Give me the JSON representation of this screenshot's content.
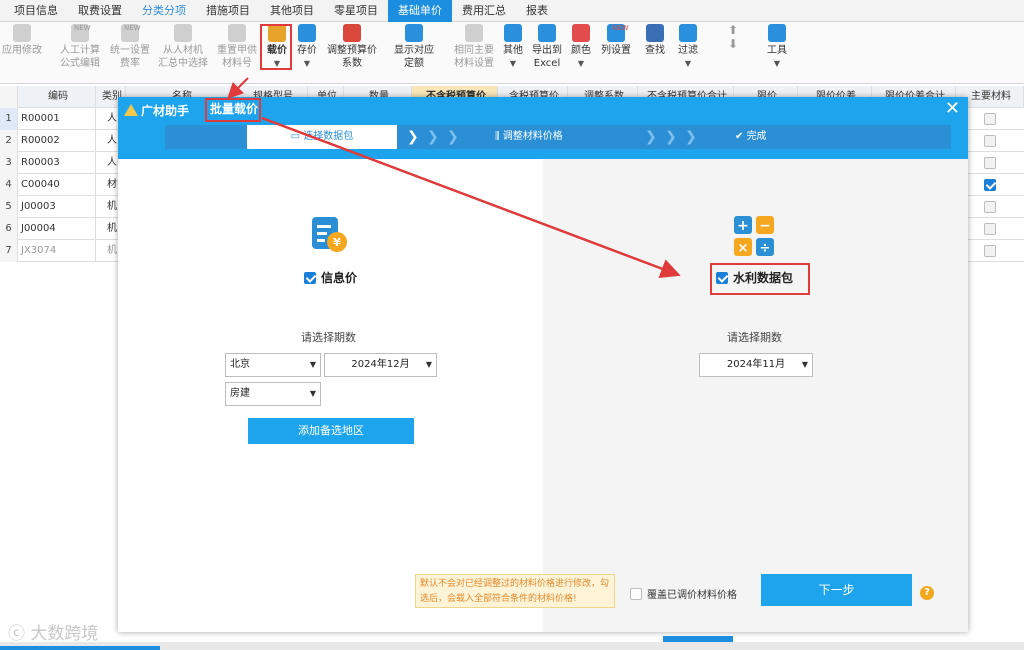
{
  "tabs": [
    "项目信息",
    "取费设置",
    "分类分项",
    "措施项目",
    "其他项目",
    "零星项目",
    "基础单价",
    "费用汇总",
    "报表"
  ],
  "ribbon": {
    "apply_modify": "应用修改",
    "labor_calc": [
      "人工计算",
      "公式编辑"
    ],
    "unify_rate": [
      "统一设置",
      "费率"
    ],
    "from_summary": [
      "从人材机",
      "汇总中选择"
    ],
    "reset_supplied": [
      "重置甲供",
      "材料号"
    ],
    "load_price": "载价",
    "save_price": "存价",
    "adjust_coef": [
      "调整预算价",
      "系数"
    ],
    "show_quota": [
      "显示对应",
      "定额"
    ],
    "same_material": [
      "相同主要",
      "材料设置"
    ],
    "other": "其他",
    "export_excel": [
      "导出到",
      "Excel"
    ],
    "color": "颜色",
    "col_settings": "列设置",
    "find": "查找",
    "filter": "过滤",
    "tools": "工具",
    "new_badge": "NEW"
  },
  "grid": {
    "headers": [
      "编码",
      "类别",
      "名称",
      "规格型号",
      "单位",
      "数量",
      "不含税预算价",
      "含税预算价",
      "调整系数",
      "不含税预算价合计",
      "限价",
      "限价价差",
      "限价价差合计",
      "主要材料"
    ],
    "rows": [
      {
        "num": "1",
        "code": "R00001",
        "type": "人",
        "main": false
      },
      {
        "num": "2",
        "code": "R00002",
        "type": "人",
        "main": false
      },
      {
        "num": "3",
        "code": "R00003",
        "type": "人",
        "main": false
      },
      {
        "num": "4",
        "code": "C00040",
        "type": "材",
        "main": true
      },
      {
        "num": "5",
        "code": "J00003",
        "type": "机",
        "main": false
      },
      {
        "num": "6",
        "code": "J00004",
        "type": "机",
        "main": false
      },
      {
        "num": "7",
        "code": "JX3074",
        "type": "机",
        "main": false
      }
    ]
  },
  "modal": {
    "logo": "广材助手",
    "title": "批量载价",
    "close": "✕",
    "steps": [
      "选择数据包",
      "调整材料价格",
      "完成"
    ],
    "left": {
      "label": "信息价",
      "period_label": "请选择期数",
      "region": "北京",
      "period": "2024年12月",
      "category": "房建",
      "add_button": "添加备选地区"
    },
    "right": {
      "label": "水利数据包",
      "period_label": "请选择期数",
      "period": "2024年11月"
    },
    "tip": "默认不会对已经调整过的材料价格进行修改，勾选后，会载入全部符合条件的材料价格!",
    "cover_label": "覆盖已调价材料价格",
    "next_button": "下一步",
    "help": "?"
  },
  "watermark": "大数跨境",
  "colors": {
    "accent": "#1ea4ec",
    "highlight": "#e03a3a",
    "tab_active": "#1b8ee0"
  }
}
